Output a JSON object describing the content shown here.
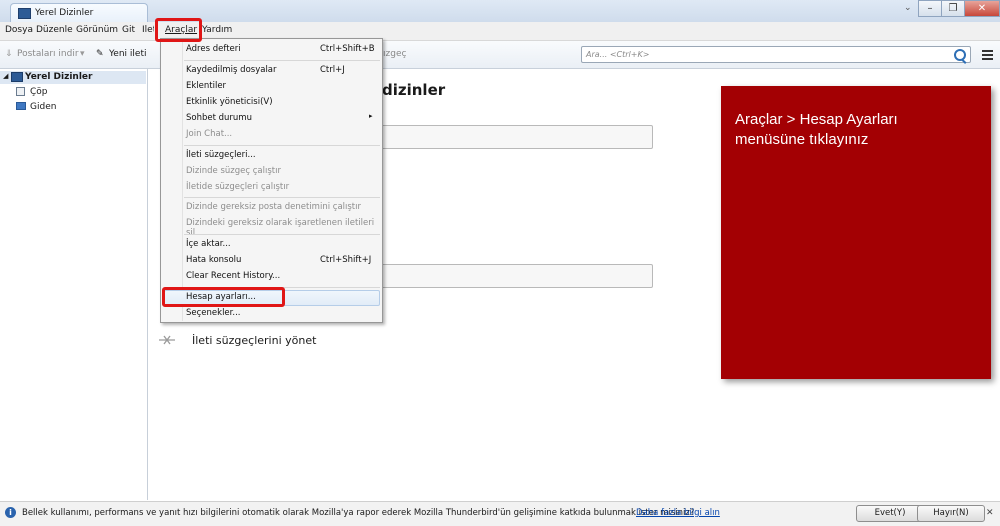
{
  "window": {
    "tab_title": "Yerel Dizinler",
    "controls": [
      "–",
      "❐",
      "✕"
    ]
  },
  "menubar": {
    "items": [
      "Dosya",
      "Düzenle",
      "Görünüm",
      "Git",
      "İleti",
      "Araçlar",
      "Yardım"
    ]
  },
  "toolbar": {
    "get_messages": "Postaları indir",
    "new_message": "Yeni ileti",
    "filter_partial": "ızgeç",
    "search_placeholder": "Ara... <Ctrl+K>"
  },
  "sidebar": {
    "root": "Yerel Dizinler",
    "folders": [
      "Çöp",
      "Giden"
    ]
  },
  "main": {
    "heading_partial": "dizinler",
    "manage_filters": "İleti süzgeçlerini yönet"
  },
  "callout": {
    "text": "Araçlar > Hesap Ayarları\nmenüsüne tıklayınız",
    "color": "#a30003"
  },
  "tools_menu": {
    "items": [
      {
        "label": "Adres defteri",
        "shortcut": "Ctrl+Shift+B",
        "disabled": false
      },
      {
        "label": "Kaydedilmiş dosyalar",
        "shortcut": "Ctrl+J",
        "disabled": false
      },
      {
        "label": "Eklentiler",
        "shortcut": "",
        "disabled": false
      },
      {
        "label": "Etkinlik yöneticisi(V)",
        "shortcut": "",
        "disabled": false
      },
      {
        "label": "Sohbet durumu",
        "shortcut": "▸",
        "disabled": false
      },
      {
        "label": "Join Chat...",
        "shortcut": "",
        "disabled": true
      },
      {
        "label": "İleti süzgeçleri...",
        "shortcut": "",
        "disabled": false
      },
      {
        "label": "Dizinde süzgeç çalıştır",
        "shortcut": "",
        "disabled": true
      },
      {
        "label": "İletide süzgeçleri çalıştır",
        "shortcut": "",
        "disabled": true
      },
      {
        "label": "Dizinde gereksiz posta denetimini çalıştır",
        "shortcut": "",
        "disabled": true
      },
      {
        "label": "Dizindeki gereksiz olarak işaretlenen iletileri sil",
        "shortcut": "",
        "disabled": true
      },
      {
        "label": "İçe aktar...",
        "shortcut": "",
        "disabled": false
      },
      {
        "label": "Hata konsolu",
        "shortcut": "Ctrl+Shift+J",
        "disabled": false
      },
      {
        "label": "Clear Recent History...",
        "shortcut": "",
        "disabled": false
      },
      {
        "label": "Hesap ayarları...",
        "shortcut": "",
        "disabled": false
      },
      {
        "label": "Seçenekler...",
        "shortcut": "",
        "disabled": false
      }
    ]
  },
  "notification": {
    "message": "Bellek kullanımı, performans ve yanıt hızı bilgilerini otomatik olarak Mozilla'ya rapor ederek Mozilla Thunderbird'ün gelişimine katkıda bulunmak ister misiniz?",
    "link": "Daha fazla bilgi alın",
    "yes": "Evet(Y)",
    "no": "Hayır(N)",
    "close": "✕"
  }
}
